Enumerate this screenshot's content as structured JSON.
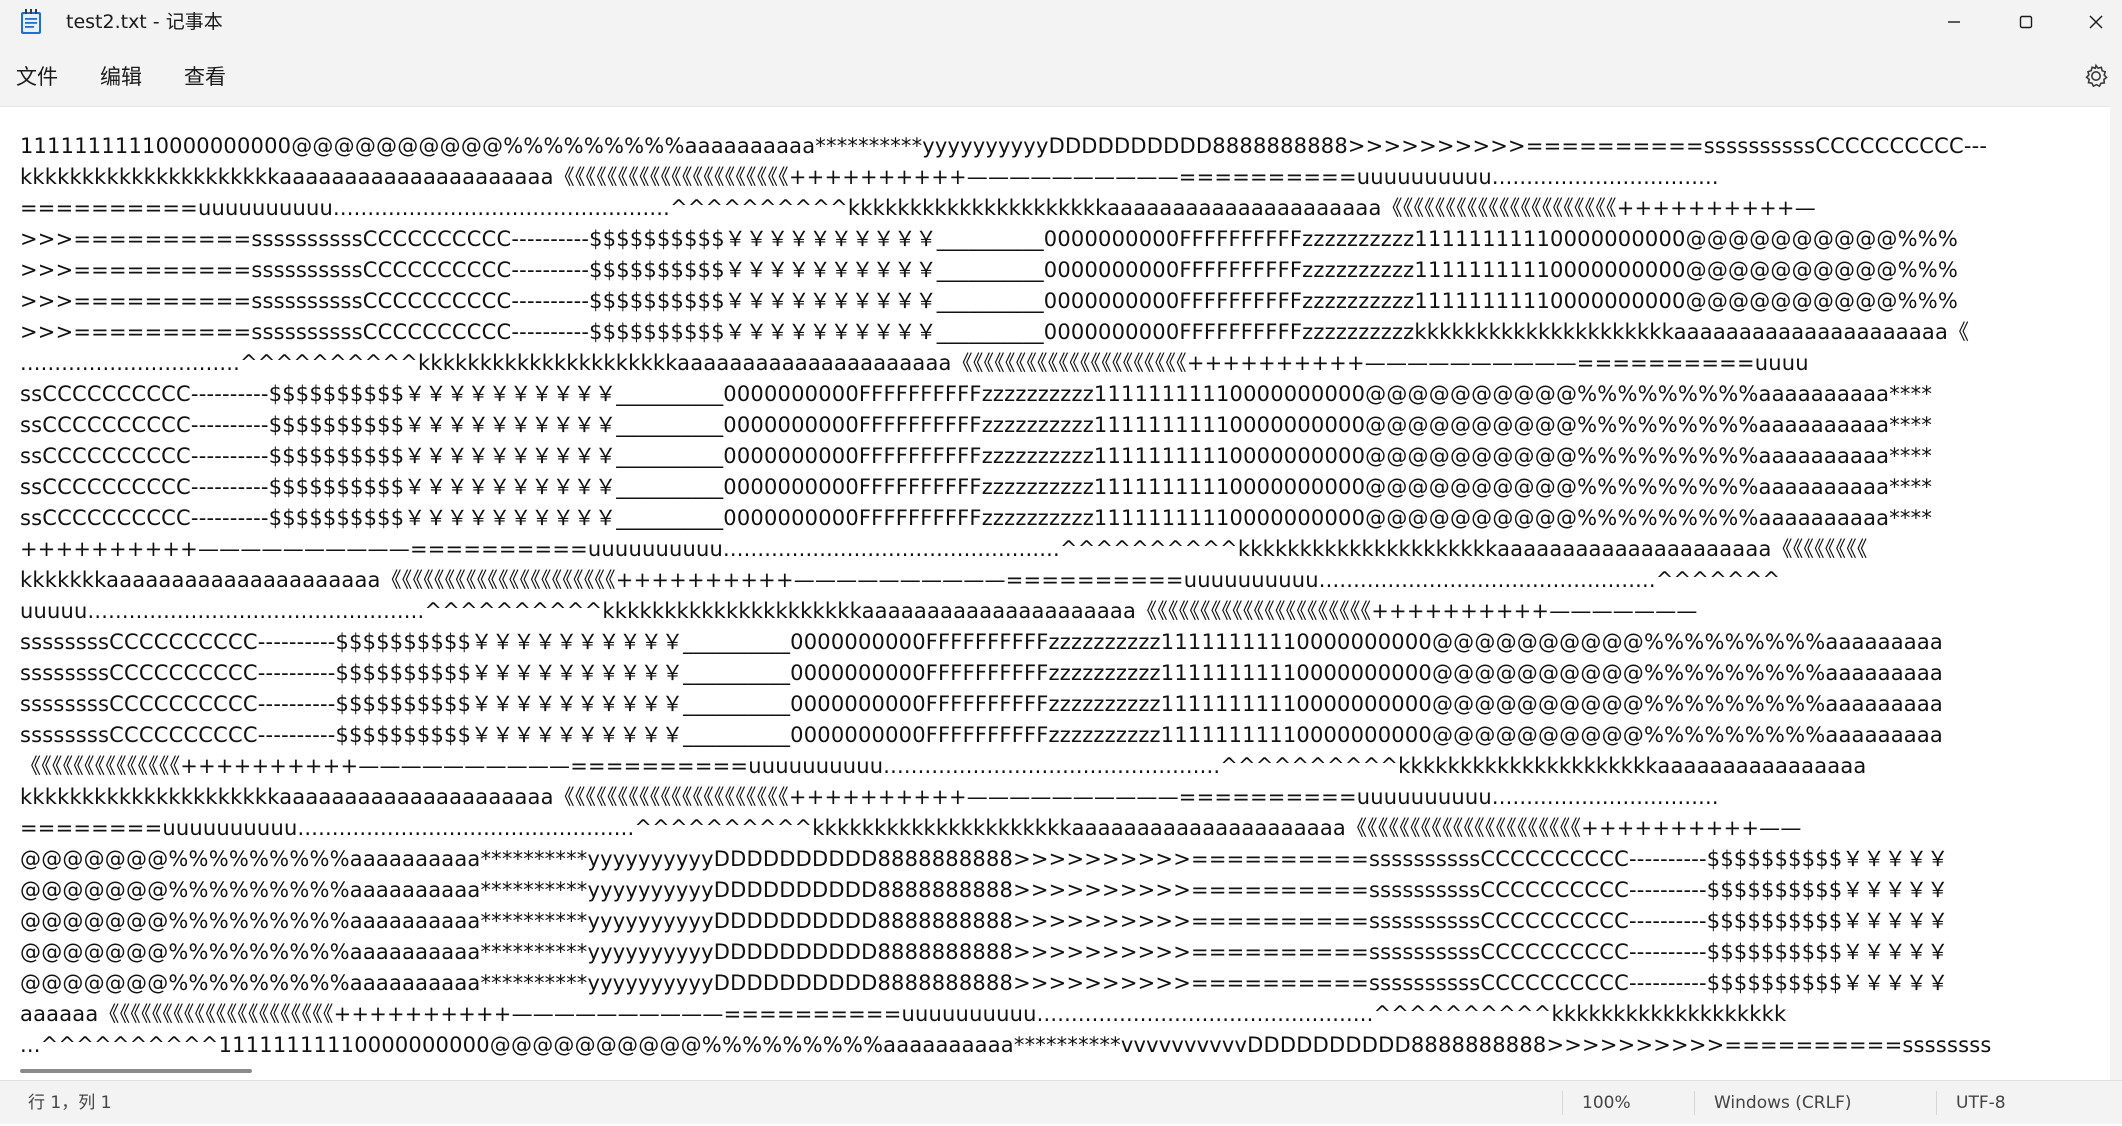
{
  "window": {
    "title": "test2.txt - 记事本",
    "icons": {
      "app": "notepad-icon",
      "minimize": "minimize-icon",
      "maximize": "maximize-icon",
      "close": "close-icon"
    }
  },
  "menu": {
    "file": "文件",
    "edit": "编辑",
    "view": "查看",
    "settings_icon": "gear-icon"
  },
  "editor": {
    "lines": [
      "11111111110000000000@@@@@@@@@@%%%%%%%%%aaaaaaaaaa**********yyyyyyyyyyDDDDDDDDDD8888888888>>>>>>>>>>==========ssssssssssCCCCCCCCCC---",
      "kkkkkkkkkkkkkkkkkkkkkaaaaaaaaaaaaaaaaaaaaa《《《《《《《《《《《《《《《《《《《《《++++++++++——————————==========uuuuuuuuuu.................................",
      "==========uuuuuuuuuu.................................................^^^^^^^^^^kkkkkkkkkkkkkkkkkkkkkaaaaaaaaaaaaaaaaaaaaa《《《《《《《《《《《《《《《《《《《《《++++++++++—",
      ">>>==========ssssssssssCCCCCCCCCC----------$$$$$$$$$$￥￥￥￥￥￥￥￥￥￥__________0000000000FFFFFFFFFFzzzzzzzzzz11111111110000000000@@@@@@@@@@%%%",
      ">>>==========ssssssssssCCCCCCCCCC----------$$$$$$$$$$￥￥￥￥￥￥￥￥￥￥__________0000000000FFFFFFFFFFzzzzzzzzzz11111111110000000000@@@@@@@@@@%%%",
      ">>>==========ssssssssssCCCCCCCCCC----------$$$$$$$$$$￥￥￥￥￥￥￥￥￥￥__________0000000000FFFFFFFFFFzzzzzzzzzz11111111110000000000@@@@@@@@@@%%%",
      ">>>==========ssssssssssCCCCCCCCCC----------$$$$$$$$$$￥￥￥￥￥￥￥￥￥￥__________0000000000FFFFFFFFFFzzzzzzzzzzkkkkkkkkkkkkkkkkkkkkkaaaaaaaaaaaaaaaaaaaaa《",
      "................................^^^^^^^^^^kkkkkkkkkkkkkkkkkkkkkaaaaaaaaaaaaaaaaaaaaa《《《《《《《《《《《《《《《《《《《《《++++++++++——————————==========uuuu",
      "ssCCCCCCCCCC----------$$$$$$$$$$￥￥￥￥￥￥￥￥￥￥__________0000000000FFFFFFFFFFzzzzzzzzzz11111111110000000000@@@@@@@@@@%%%%%%%%%aaaaaaaaaa****",
      "ssCCCCCCCCCC----------$$$$$$$$$$￥￥￥￥￥￥￥￥￥￥__________0000000000FFFFFFFFFFzzzzzzzzzz11111111110000000000@@@@@@@@@@%%%%%%%%%aaaaaaaaaa****",
      "ssCCCCCCCCCC----------$$$$$$$$$$￥￥￥￥￥￥￥￥￥￥__________0000000000FFFFFFFFFFzzzzzzzzzz11111111110000000000@@@@@@@@@@%%%%%%%%%aaaaaaaaaa****",
      "ssCCCCCCCCCC----------$$$$$$$$$$￥￥￥￥￥￥￥￥￥￥__________0000000000FFFFFFFFFFzzzzzzzzzz11111111110000000000@@@@@@@@@@%%%%%%%%%aaaaaaaaaa****",
      "ssCCCCCCCCCC----------$$$$$$$$$$￥￥￥￥￥￥￥￥￥￥__________0000000000FFFFFFFFFFzzzzzzzzzz11111111110000000000@@@@@@@@@@%%%%%%%%%aaaaaaaaaa****",
      "++++++++++——————————==========uuuuuuuuuu.................................................^^^^^^^^^^kkkkkkkkkkkkkkkkkkkkkaaaaaaaaaaaaaaaaaaaaa《《《《《《《《",
      "kkkkkkkaaaaaaaaaaaaaaaaaaaaa《《《《《《《《《《《《《《《《《《《《《++++++++++——————————==========uuuuuuuuuu.................................................^^^^^^^",
      "uuuuu.................................................^^^^^^^^^^kkkkkkkkkkkkkkkkkkkkkaaaaaaaaaaaaaaaaaaaaa《《《《《《《《《《《《《《《《《《《《《++++++++++———————",
      "ssssssssCCCCCCCCCC----------$$$$$$$$$$￥￥￥￥￥￥￥￥￥￥__________0000000000FFFFFFFFFFzzzzzzzzzz11111111110000000000@@@@@@@@@@%%%%%%%%%aaaaaaaaa",
      "ssssssssCCCCCCCCCC----------$$$$$$$$$$￥￥￥￥￥￥￥￥￥￥__________0000000000FFFFFFFFFFzzzzzzzzzz11111111110000000000@@@@@@@@@@%%%%%%%%%aaaaaaaaa",
      "ssssssssCCCCCCCCCC----------$$$$$$$$$$￥￥￥￥￥￥￥￥￥￥__________0000000000FFFFFFFFFFzzzzzzzzzz11111111110000000000@@@@@@@@@@%%%%%%%%%aaaaaaaaa",
      "ssssssssCCCCCCCCCC----------$$$$$$$$$$￥￥￥￥￥￥￥￥￥￥__________0000000000FFFFFFFFFFzzzzzzzzzz11111111110000000000@@@@@@@@@@%%%%%%%%%aaaaaaaaa",
      "《《《《《《《《《《《《《《++++++++++——————————==========uuuuuuuuuu.................................................^^^^^^^^^^kkkkkkkkkkkkkkkkkkkkkaaaaaaaaaaaaaaaa",
      "kkkkkkkkkkkkkkkkkkkkkaaaaaaaaaaaaaaaaaaaaa《《《《《《《《《《《《《《《《《《《《《++++++++++——————————==========uuuuuuuuuu.................................",
      "========uuuuuuuuuu.................................................^^^^^^^^^^kkkkkkkkkkkkkkkkkkkkkaaaaaaaaaaaaaaaaaaaaa《《《《《《《《《《《《《《《《《《《《《++++++++++——",
      "@@@@@@@%%%%%%%%%aaaaaaaaaa**********yyyyyyyyyyDDDDDDDDDD8888888888>>>>>>>>>>==========ssssssssssCCCCCCCCCC----------$$$$$$$$$$￥￥￥￥￥",
      "@@@@@@@%%%%%%%%%aaaaaaaaaa**********yyyyyyyyyyDDDDDDDDDD8888888888>>>>>>>>>>==========ssssssssssCCCCCCCCCC----------$$$$$$$$$$￥￥￥￥￥",
      "@@@@@@@%%%%%%%%%aaaaaaaaaa**********yyyyyyyyyyDDDDDDDDDD8888888888>>>>>>>>>>==========ssssssssssCCCCCCCCCC----------$$$$$$$$$$￥￥￥￥￥",
      "@@@@@@@%%%%%%%%%aaaaaaaaaa**********yyyyyyyyyyDDDDDDDDDD8888888888>>>>>>>>>>==========ssssssssssCCCCCCCCCC----------$$$$$$$$$$￥￥￥￥￥",
      "@@@@@@@%%%%%%%%%aaaaaaaaaa**********yyyyyyyyyyDDDDDDDDDD8888888888>>>>>>>>>>==========ssssssssssCCCCCCCCCC----------$$$$$$$$$$￥￥￥￥￥",
      "aaaaaa《《《《《《《《《《《《《《《《《《《《《++++++++++——————————==========uuuuuuuuuu.................................................^^^^^^^^^^kkkkkkkkkkkkkkkkkkk",
      "...^^^^^^^^^^11111111110000000000@@@@@@@@@@%%%%%%%%%aaaaaaaaaa**********vvvvvvvvvvDDDDDDDDDD8888888888>>>>>>>>>>==========ssssssss"
    ]
  },
  "status": {
    "position": "行 1，列 1",
    "zoom": "100%",
    "line_ending": "Windows (CRLF)",
    "encoding": "UTF-8"
  }
}
